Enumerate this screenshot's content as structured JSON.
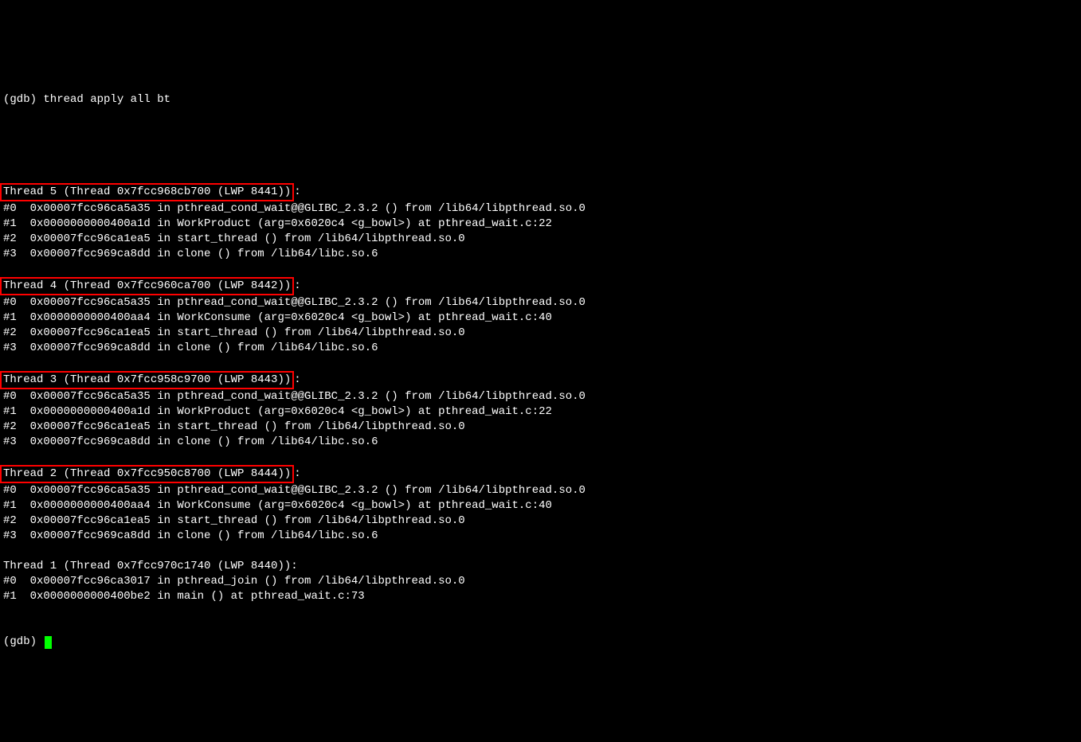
{
  "header": {
    "command": "(gdb) thread apply all bt"
  },
  "threads": [
    {
      "label": "Thread 5 (Thread 0x7fcc968cb700 (LWP 8441))",
      "highlighted": true,
      "frames": [
        "#0  0x00007fcc96ca5a35 in pthread_cond_wait@@GLIBC_2.3.2 () from /lib64/libpthread.so.0",
        "#1  0x0000000000400a1d in WorkProduct (arg=0x6020c4 <g_bowl>) at pthread_wait.c:22",
        "#2  0x00007fcc96ca1ea5 in start_thread () from /lib64/libpthread.so.0",
        "#3  0x00007fcc969ca8dd in clone () from /lib64/libc.so.6"
      ]
    },
    {
      "label": "Thread 4 (Thread 0x7fcc960ca700 (LWP 8442))",
      "highlighted": true,
      "frames": [
        "#0  0x00007fcc96ca5a35 in pthread_cond_wait@@GLIBC_2.3.2 () from /lib64/libpthread.so.0",
        "#1  0x0000000000400aa4 in WorkConsume (arg=0x6020c4 <g_bowl>) at pthread_wait.c:40",
        "#2  0x00007fcc96ca1ea5 in start_thread () from /lib64/libpthread.so.0",
        "#3  0x00007fcc969ca8dd in clone () from /lib64/libc.so.6"
      ]
    },
    {
      "label": "Thread 3 (Thread 0x7fcc958c9700 (LWP 8443))",
      "highlighted": true,
      "frames": [
        "#0  0x00007fcc96ca5a35 in pthread_cond_wait@@GLIBC_2.3.2 () from /lib64/libpthread.so.0",
        "#1  0x0000000000400a1d in WorkProduct (arg=0x6020c4 <g_bowl>) at pthread_wait.c:22",
        "#2  0x00007fcc96ca1ea5 in start_thread () from /lib64/libpthread.so.0",
        "#3  0x00007fcc969ca8dd in clone () from /lib64/libc.so.6"
      ]
    },
    {
      "label": "Thread 2 (Thread 0x7fcc950c8700 (LWP 8444))",
      "highlighted": true,
      "frames": [
        "#0  0x00007fcc96ca5a35 in pthread_cond_wait@@GLIBC_2.3.2 () from /lib64/libpthread.so.0",
        "#1  0x0000000000400aa4 in WorkConsume (arg=0x6020c4 <g_bowl>) at pthread_wait.c:40",
        "#2  0x00007fcc96ca1ea5 in start_thread () from /lib64/libpthread.so.0",
        "#3  0x00007fcc969ca8dd in clone () from /lib64/libc.so.6"
      ]
    },
    {
      "label": "Thread 1 (Thread 0x7fcc970c1740 (LWP 8440)):",
      "highlighted": false,
      "frames": [
        "#0  0x00007fcc96ca3017 in pthread_join () from /lib64/libpthread.so.0",
        "#1  0x0000000000400be2 in main () at pthread_wait.c:73"
      ]
    }
  ],
  "prompt": {
    "text": "(gdb) "
  }
}
